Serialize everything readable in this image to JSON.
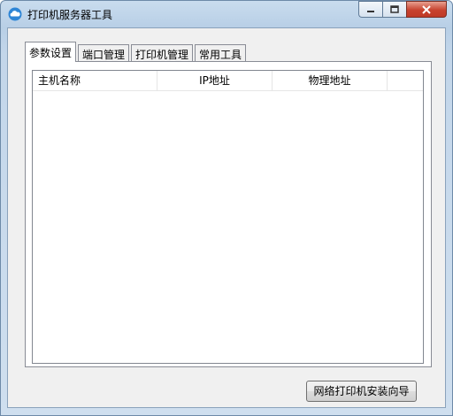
{
  "window": {
    "title": "打印机服务器工具",
    "icon": "cloud-icon",
    "controls": [
      "minimize-icon",
      "maximize-icon",
      "close-icon"
    ]
  },
  "tabs": [
    {
      "label": "参数设置",
      "active": true
    },
    {
      "label": "端口管理",
      "active": false
    },
    {
      "label": "打印机管理",
      "active": false
    },
    {
      "label": "常用工具",
      "active": false
    }
  ],
  "table": {
    "columns": [
      "主机名称",
      "IP地址",
      "物理地址"
    ],
    "rows": []
  },
  "buttons": {
    "install_wizard": "网络打印机安装向导"
  },
  "colors": {
    "title_bar": "#c9dcee",
    "close_button": "#c7432f",
    "client_bg": "#f0f0f0"
  }
}
